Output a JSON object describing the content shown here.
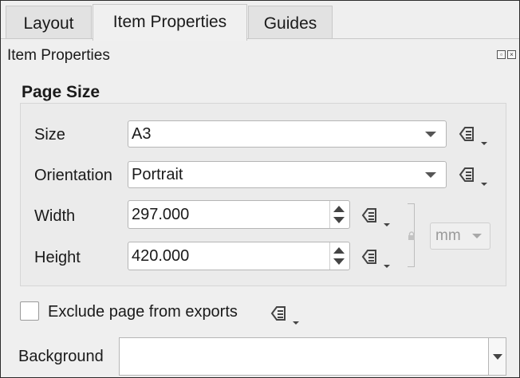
{
  "tabs": [
    {
      "label": "Layout",
      "active": false
    },
    {
      "label": "Item Properties",
      "active": true
    },
    {
      "label": "Guides",
      "active": false
    }
  ],
  "panel": {
    "title": "Item Properties"
  },
  "page_size": {
    "group_title": "Page Size",
    "size": {
      "label": "Size",
      "value": "A3"
    },
    "orientation": {
      "label": "Orientation",
      "value": "Portrait"
    },
    "width": {
      "label": "Width",
      "value": "297.000"
    },
    "height": {
      "label": "Height",
      "value": "420.000"
    },
    "unit": {
      "value": "mm",
      "enabled": false
    }
  },
  "exclude": {
    "label": "Exclude page from exports",
    "checked": false
  },
  "background": {
    "label": "Background",
    "value": ""
  },
  "icons": {
    "data_defined": "data-defined-override-icon",
    "lock": "lock-icon"
  }
}
